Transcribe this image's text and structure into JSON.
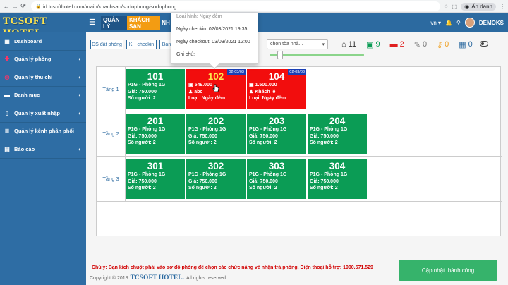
{
  "browser": {
    "url": "id.tcsofthotel.com/main/khachsan/sodophong/sodophong",
    "incognito_label": "Ẩn danh"
  },
  "header": {
    "logo": "TCSOFT HOTEL",
    "nav_quanly": "QUẢN LÝ",
    "nav_khachsan": "KHÁCH SẠN",
    "nav_more": "NH",
    "language": "vn",
    "username": "DEMOKS"
  },
  "sidebar": {
    "items": [
      {
        "label": "Dashboard",
        "icon": "dashboard-icon",
        "has_submenu": false
      },
      {
        "label": "Quản lý phòng",
        "icon": "bed-icon",
        "has_submenu": true
      },
      {
        "label": "Quản lý thu chi",
        "icon": "money-icon",
        "has_submenu": true
      },
      {
        "label": "Danh mục",
        "icon": "folder-icon",
        "has_submenu": true
      },
      {
        "label": "Quản lý xuất nhập",
        "icon": "file-icon",
        "has_submenu": true
      },
      {
        "label": "Quản lý kênh phân phối",
        "icon": "list-icon",
        "has_submenu": false
      },
      {
        "label": "Báo cáo",
        "icon": "report-icon",
        "has_submenu": true
      }
    ]
  },
  "toolbar": {
    "btn_ds_dat_phong": "DS đặt phòng",
    "btn_kh_checkin": "KH checkin",
    "btn_ban": "Bản",
    "select_placeholder": "chọn tòa nhà...",
    "slider_level": 0.08,
    "stats": [
      {
        "icon": "home-icon",
        "value": "11",
        "color": "#333333"
      },
      {
        "icon": "room-available-icon",
        "value": "9",
        "color": "#0b9c55"
      },
      {
        "icon": "bed-occupied-icon",
        "value": "2",
        "color": "#e02020"
      },
      {
        "icon": "wrench-icon",
        "value": "0",
        "color": "#777777"
      },
      {
        "icon": "key-icon",
        "value": "0",
        "color": "#f0a020"
      },
      {
        "icon": "calendar-icon",
        "value": "0",
        "color": "#2c6aa0"
      }
    ]
  },
  "popup": {
    "line1": "Loại hình: Ngày đêm",
    "line2": "Ngày checkin: 02/03/2021 19:35",
    "line3": "Ngày checkout: 03/03/2021 12:00",
    "line4": "Ghi chú:"
  },
  "floors": [
    {
      "label": "Tầng 1",
      "rooms": [
        {
          "number": "101",
          "status": "vacant",
          "line1": "P1G - Phòng 1G",
          "line2": "Giá: 750.000",
          "line3": "Số người: 2"
        },
        {
          "number": "102",
          "status": "occupied",
          "date": "02-03/03",
          "line1": "549.000",
          "line2": "abc",
          "line3": "Loại: Ngày đêm"
        },
        {
          "number": "104",
          "status": "occupied",
          "date": "02-03/03",
          "line1": "1.500.000",
          "line2": "Khách lẻ",
          "line3": "Loại: Ngày đêm"
        }
      ]
    },
    {
      "label": "Tầng 2",
      "rooms": [
        {
          "number": "201",
          "status": "vacant",
          "line1": "P1G - Phòng 1G",
          "line2": "Giá: 750.000",
          "line3": "Số người: 2"
        },
        {
          "number": "202",
          "status": "vacant",
          "line1": "P1G - Phòng 1G",
          "line2": "Giá: 750.000",
          "line3": "Số người: 2"
        },
        {
          "number": "203",
          "status": "vacant",
          "line1": "P1G - Phòng 1G",
          "line2": "Giá: 750.000",
          "line3": "Số người: 2"
        },
        {
          "number": "204",
          "status": "vacant",
          "line1": "P1G - Phòng 1G",
          "line2": "Giá: 750.000",
          "line3": "Số người: 2"
        }
      ]
    },
    {
      "label": "Tầng 3",
      "rooms": [
        {
          "number": "301",
          "status": "vacant",
          "line1": "P1G - Phòng 1G",
          "line2": "Giá: 750.000",
          "line3": "Số người: 2"
        },
        {
          "number": "302",
          "status": "vacant",
          "line1": "P1G - Phòng 1G",
          "line2": "Giá: 750.000",
          "line3": "Số người: 2"
        },
        {
          "number": "303",
          "status": "vacant",
          "line1": "P1G - Phòng 1G",
          "line2": "Giá: 750.000",
          "line3": "Số người: 2"
        },
        {
          "number": "304",
          "status": "vacant",
          "line1": "P1G - Phòng 1G",
          "line2": "Giá: 750.000",
          "line3": "Số người: 2"
        }
      ]
    }
  ],
  "note": "Chú ý: Bạn kích chuột phải vào sơ đồ phòng để chọn các chức năng về nhận trả phòng. Điện thoại hỗ trợ: 1900.571.529",
  "footer": {
    "prefix": "Copyright © 2018",
    "brand": "TCSOFT HOTEL.",
    "suffix": "All rights reserved."
  },
  "update_button": "Cập nhật thành công",
  "colors": {
    "primary": "#2c6aa0",
    "vacant": "#0b9c55",
    "occupied": "#f20d0d",
    "logo": "#ffe44d"
  }
}
